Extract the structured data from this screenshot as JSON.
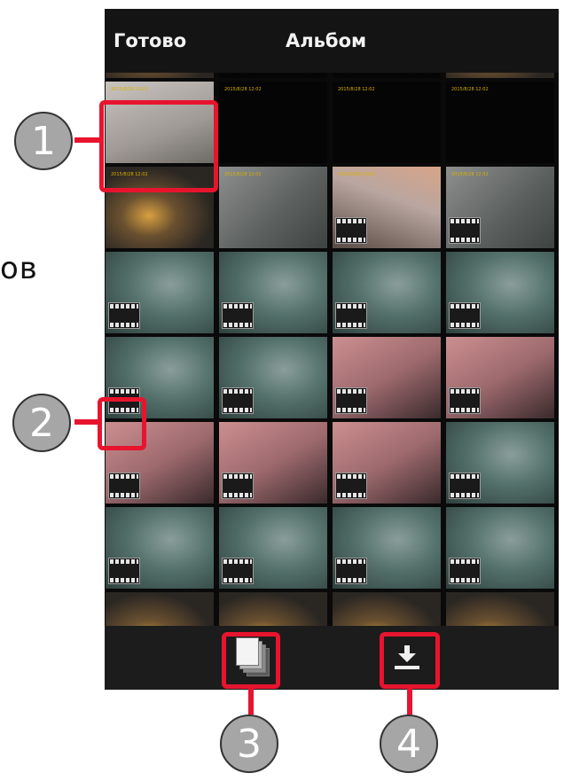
{
  "background_text": "ов",
  "header": {
    "done_label": "Готово",
    "title": "Альбом"
  },
  "grid": {
    "stamp_text": "2015/8/28 12:02",
    "cells": [
      {
        "row": 0,
        "col": 0,
        "kind": "photo",
        "scene": "desk"
      },
      {
        "row": 0,
        "col": 1,
        "kind": "photo",
        "scene": "dark"
      },
      {
        "row": 0,
        "col": 2,
        "kind": "photo",
        "scene": "dark"
      },
      {
        "row": 0,
        "col": 3,
        "kind": "photo",
        "scene": "desk"
      },
      {
        "row": 1,
        "col": 0,
        "kind": "photo",
        "scene": "paper",
        "stamp": true
      },
      {
        "row": 1,
        "col": 1,
        "kind": "photo",
        "scene": "black",
        "stamp": true
      },
      {
        "row": 1,
        "col": 2,
        "kind": "photo",
        "scene": "black",
        "stamp": true
      },
      {
        "row": 1,
        "col": 3,
        "kind": "photo",
        "scene": "black",
        "stamp": true
      },
      {
        "row": 2,
        "col": 0,
        "kind": "photo",
        "scene": "desk",
        "stamp": true
      },
      {
        "row": 2,
        "col": 1,
        "kind": "photo",
        "scene": "gray",
        "stamp": true
      },
      {
        "row": 2,
        "col": 2,
        "kind": "video",
        "scene": "paperdesk",
        "stamp": true
      },
      {
        "row": 2,
        "col": 3,
        "kind": "video",
        "scene": "gray",
        "stamp": true
      },
      {
        "row": 3,
        "col": 0,
        "kind": "video",
        "scene": "teal"
      },
      {
        "row": 3,
        "col": 1,
        "kind": "video",
        "scene": "teal"
      },
      {
        "row": 3,
        "col": 2,
        "kind": "video",
        "scene": "teal"
      },
      {
        "row": 3,
        "col": 3,
        "kind": "video",
        "scene": "teal"
      },
      {
        "row": 4,
        "col": 0,
        "kind": "video",
        "scene": "teal"
      },
      {
        "row": 4,
        "col": 1,
        "kind": "video",
        "scene": "teal"
      },
      {
        "row": 4,
        "col": 2,
        "kind": "video",
        "scene": "pink"
      },
      {
        "row": 4,
        "col": 3,
        "kind": "video",
        "scene": "pink"
      },
      {
        "row": 5,
        "col": 0,
        "kind": "video",
        "scene": "pink"
      },
      {
        "row": 5,
        "col": 1,
        "kind": "video",
        "scene": "pink"
      },
      {
        "row": 5,
        "col": 2,
        "kind": "video",
        "scene": "pink"
      },
      {
        "row": 5,
        "col": 3,
        "kind": "video",
        "scene": "teal"
      },
      {
        "row": 6,
        "col": 0,
        "kind": "video",
        "scene": "teal"
      },
      {
        "row": 6,
        "col": 1,
        "kind": "video",
        "scene": "teal"
      },
      {
        "row": 6,
        "col": 2,
        "kind": "video",
        "scene": "teal"
      },
      {
        "row": 6,
        "col": 3,
        "kind": "video",
        "scene": "teal"
      },
      {
        "row": 7,
        "col": 0,
        "kind": "photo",
        "scene": "desk"
      },
      {
        "row": 7,
        "col": 1,
        "kind": "photo",
        "scene": "desk"
      },
      {
        "row": 7,
        "col": 2,
        "kind": "photo",
        "scene": "desk"
      },
      {
        "row": 7,
        "col": 3,
        "kind": "photo",
        "scene": "desk"
      }
    ]
  },
  "toolbar": {
    "select_icon": "stacked-pages-icon",
    "download_icon": "download-icon"
  },
  "annotations": {
    "marker_1": "1",
    "marker_2": "2",
    "marker_3": "3",
    "marker_4": "4",
    "callout_color": "#e8142e"
  },
  "colors": {
    "bar_bg": "#141414",
    "grid_bg": "#0a0a0a",
    "stamp": "#d8b000"
  }
}
